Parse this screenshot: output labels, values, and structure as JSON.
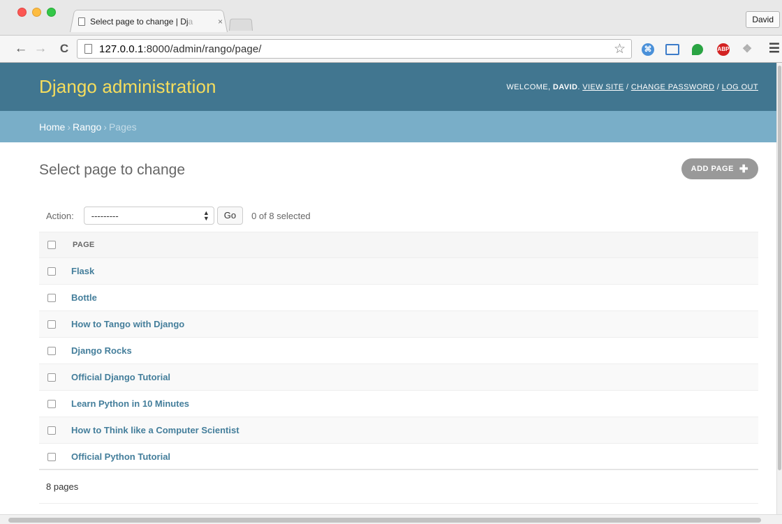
{
  "browser": {
    "tab_title": "Select page to change | Dj",
    "tab_title_fade": "a",
    "tab_close": "×",
    "profile_name": "David",
    "url_host": "127.0.0.1",
    "url_rest": ":8000/admin/rango/page/",
    "ext_abp": "ABP"
  },
  "header": {
    "brand": "Django administration",
    "welcome": "WELCOME, ",
    "user": "DAVID",
    "view_site": "VIEW SITE",
    "change_password": "CHANGE PASSWORD",
    "log_out": "LOG OUT"
  },
  "breadcrumbs": {
    "home": "Home",
    "app": "Rango",
    "current": "Pages",
    "sep": "›"
  },
  "content": {
    "title": "Select page to change",
    "add_button": "ADD PAGE",
    "action_label": "Action:",
    "action_value": "---------",
    "go_button": "Go",
    "selected_count": "0 of 8 selected",
    "column_header": "PAGE",
    "rows": [
      "Flask",
      "Bottle",
      "How to Tango with Django",
      "Django Rocks",
      "Official Django Tutorial",
      "Learn Python in 10 Minutes",
      "How to Think like a Computer Scientist",
      "Official Python Tutorial"
    ],
    "paginator": "8 pages"
  },
  "colors": {
    "header_bg": "#417690",
    "brand": "#f5dd5d",
    "breadcrumb_bg": "#79aec8",
    "link": "#447e9b"
  }
}
